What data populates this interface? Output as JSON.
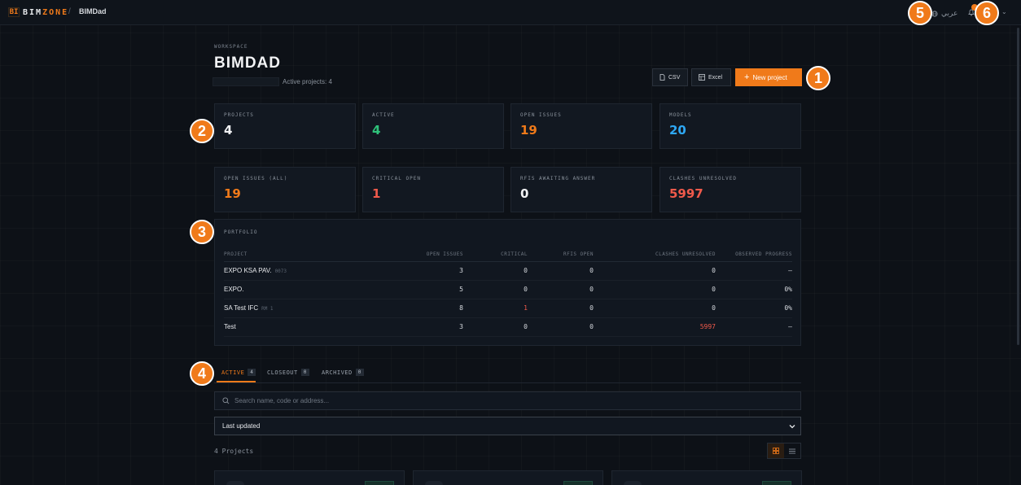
{
  "topbar": {
    "logo_mark": "BI",
    "logo_text_a": "BIM",
    "logo_text_b": "ZONE",
    "breadcrumb_sep": "/",
    "breadcrumb": "BIMDad",
    "language": "عربي"
  },
  "header": {
    "eyebrow": "WORKSPACE",
    "title": "BIMDAD",
    "subtitle": "Active projects: 4"
  },
  "actions": {
    "csv": "CSV",
    "excel": "Excel",
    "new_project": "New project"
  },
  "stats": [
    {
      "label": "PROJECTS",
      "value": "4",
      "color": "#f2f3f5"
    },
    {
      "label": "ACTIVE",
      "value": "4",
      "color": "#2fc27a"
    },
    {
      "label": "OPEN ISSUES",
      "value": "19",
      "color": "#f07a1a"
    },
    {
      "label": "MODELS",
      "value": "20",
      "color": "#2ea8f5"
    },
    {
      "label": "OPEN ISSUES (ALL)",
      "value": "19",
      "color": "#f07a1a"
    },
    {
      "label": "CRITICAL OPEN",
      "value": "1",
      "color": "#f05a4b"
    },
    {
      "label": "RFIS AWAITING ANSWER",
      "value": "0",
      "color": "#f2f3f5"
    },
    {
      "label": "CLASHES UNRESOLVED",
      "value": "5997",
      "color": "#f05a4b"
    }
  ],
  "portfolio": {
    "title": "PORTFOLIO",
    "columns": [
      "PROJECT",
      "OPEN ISSUES",
      "CRITICAL",
      "RFIS OPEN",
      "CLASHES UNRESOLVED",
      "OBSERVED PROGRESS"
    ],
    "rows": [
      {
        "name": "EXPO KSA PAV.",
        "code": "0073",
        "open": "3",
        "critical": "0",
        "rfis": "0",
        "clashes": "0",
        "progress": "—"
      },
      {
        "name": "EXPO.",
        "code": "",
        "open": "5",
        "critical": "0",
        "rfis": "0",
        "clashes": "0",
        "progress": "0%"
      },
      {
        "name": "SA Test IFC",
        "code": "RM 1",
        "open": "8",
        "critical": "1",
        "rfis": "0",
        "clashes": "0",
        "progress": "0%"
      },
      {
        "name": "Test",
        "code": "",
        "open": "3",
        "critical": "0",
        "rfis": "0",
        "clashes": "5997",
        "progress": "—"
      }
    ]
  },
  "tabs": [
    {
      "label": "ACTIVE",
      "count": "4"
    },
    {
      "label": "CLOSEOUT",
      "count": "0"
    },
    {
      "label": "ARCHIVED",
      "count": "0"
    }
  ],
  "search": {
    "placeholder": "Search name, code or address..."
  },
  "sort": {
    "selected": "Last updated"
  },
  "list": {
    "count_label": "4 Projects"
  },
  "annotations": [
    "1",
    "2",
    "3",
    "4",
    "5",
    "6"
  ],
  "accent": "#f07a1a"
}
